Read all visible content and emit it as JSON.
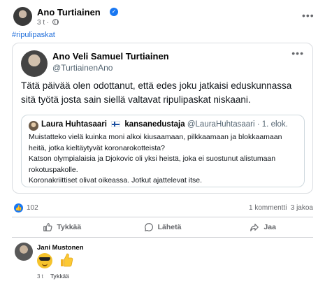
{
  "post": {
    "author": "Ano Turtiainen",
    "time": "3 t",
    "hashtag": "#ripulipaskat"
  },
  "tweet": {
    "author": "Ano Veli Samuel Turtiainen",
    "handle": "@TurtiainenAno",
    "text": "Tätä päivää olen odottanut, että edes joku jatkaisi eduskunnassa sitä työtä josta sain siellä valtavat ripulipaskat niskaani.",
    "quoted": {
      "author": "Laura Huhtasaari",
      "author_suffix": "kansanedustaja",
      "handle": "@LauraHuhtasaari · 1. elok.",
      "lines": [
        "Muistatteko vielä kuinka moni alkoi kiusaamaan, pilkkaamaan ja blokkaamaan heitä, jotka kieltäytyvät koronarokotteista?",
        "Katson olympialaisia ja Djokovic oli yksi heistä, joka ei suostunut alistumaan rokotuspakolle.",
        "Koronakriittiset olivat oikeassa. Jotkut ajattelevat itse."
      ]
    }
  },
  "stats": {
    "likes": "102",
    "comments": "1 kommentti",
    "shares": "3 jakoa"
  },
  "actions": {
    "like": "Tykkää",
    "comment": "Lähetä",
    "share": "Jaa"
  },
  "comment": {
    "author": "Jani Mustonen",
    "time": "3 t",
    "like_label": "Tykkää"
  },
  "colors": {
    "accent": "#1877f2",
    "link": "#216fdb",
    "muted": "#65676b"
  }
}
